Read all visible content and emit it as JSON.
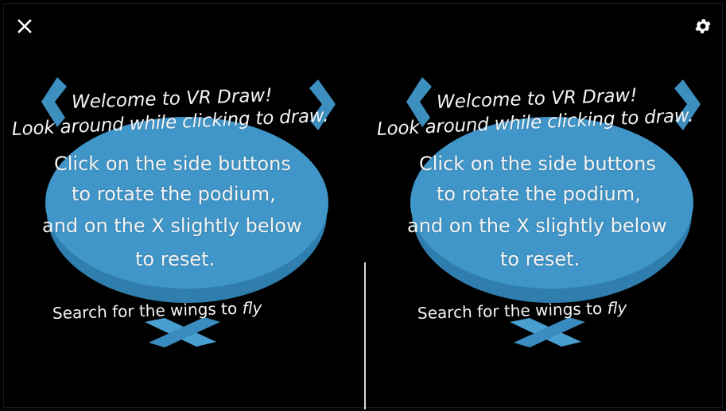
{
  "toolbar": {
    "close_icon": "close-icon",
    "settings_icon": "gear-icon"
  },
  "colors": {
    "background": "#000000",
    "podium": "#3f93c6",
    "arrows": "#3d8fc0",
    "text": "#f2f2f2"
  },
  "instructions": {
    "line1": "Welcome to VR Draw!",
    "line2": "Look around while clicking to draw.",
    "line3": "Click on the side buttons",
    "line4": "to rotate the podium,",
    "line5": "and on the X slightly below",
    "line6": "to reset.",
    "line7_a": "Search for the wings to ",
    "line7_b": "fly"
  }
}
